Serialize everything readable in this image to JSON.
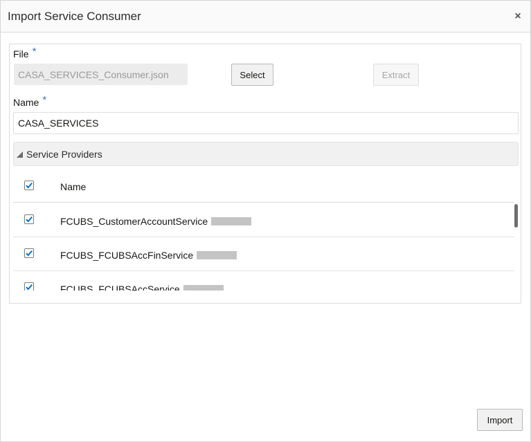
{
  "dialog": {
    "title": "Import Service Consumer",
    "close_glyph": "×"
  },
  "file": {
    "label": "File",
    "required_mark": "*",
    "value": "CASA_SERVICES_Consumer.json",
    "select_label": "Select",
    "extract_label": "Extract"
  },
  "name": {
    "label": "Name",
    "required_mark": "*",
    "value": "CASA_SERVICES"
  },
  "providers": {
    "section_label": "Service Providers",
    "column_header": "Name",
    "rows": [
      {
        "name": "FCUBS_CustomerAccountService",
        "checked": true
      },
      {
        "name": "FCUBS_FCUBSAccFinService",
        "checked": true
      },
      {
        "name": "FCUBS_FCUBSAccService",
        "checked": true
      }
    ]
  },
  "footer": {
    "import_label": "Import"
  },
  "colors": {
    "accent": "#0572ce",
    "required": "#3a75c4"
  }
}
